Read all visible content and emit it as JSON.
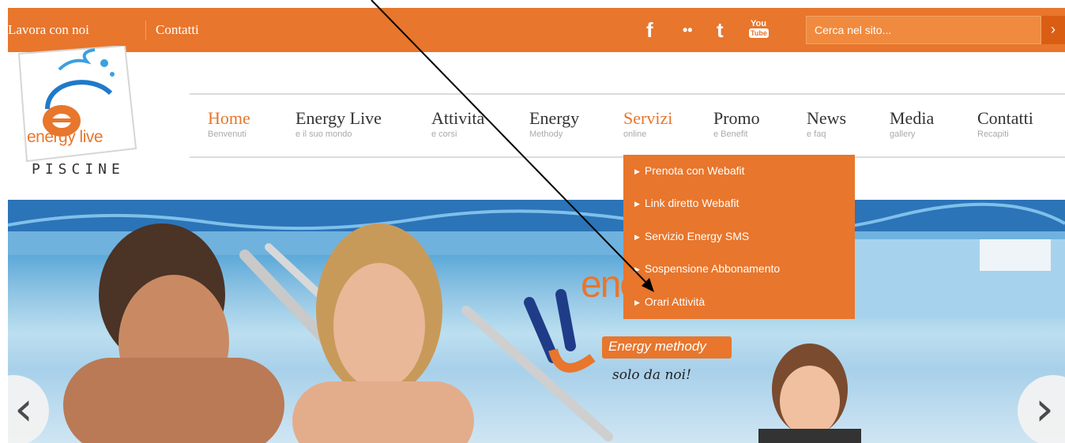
{
  "topbar": {
    "links": [
      "Lavora con noi",
      "Contatti"
    ],
    "social": {
      "facebook": "f",
      "flickr": "••",
      "twitter": "t",
      "youtube_top": "You",
      "youtube_bottom": "Tube"
    },
    "search_placeholder": "Cerca nel sito...",
    "search_button": "›"
  },
  "logo": {
    "brand": "energy live",
    "sub": "PISCINE"
  },
  "nav": [
    {
      "title": "Home",
      "sub": "Benvenuti"
    },
    {
      "title": "Energy Live",
      "sub": "e il suo mondo"
    },
    {
      "title": "Attività",
      "sub": "e corsi"
    },
    {
      "title": "Energy",
      "sub": "Methody"
    },
    {
      "title": "Servizi",
      "sub": "online"
    },
    {
      "title": "Promo",
      "sub": "e Benefit"
    },
    {
      "title": "News",
      "sub": "e faq"
    },
    {
      "title": "Media",
      "sub": "gallery"
    },
    {
      "title": "Contatti",
      "sub": "Recapiti"
    }
  ],
  "dropdown": [
    "Prenota con Webafit",
    "Link diretto Webafit",
    "Servizio Energy SMS",
    "Sospensione Abbonamento",
    "Orari Attività"
  ],
  "hero": {
    "brand_text": "ene",
    "badge": "Energy methody",
    "tagline": "solo da noi!",
    "prev": "‹",
    "next": "›"
  },
  "colors": {
    "accent": "#e8762c",
    "accent_dark": "#d95e14",
    "nav_text": "#333333"
  }
}
